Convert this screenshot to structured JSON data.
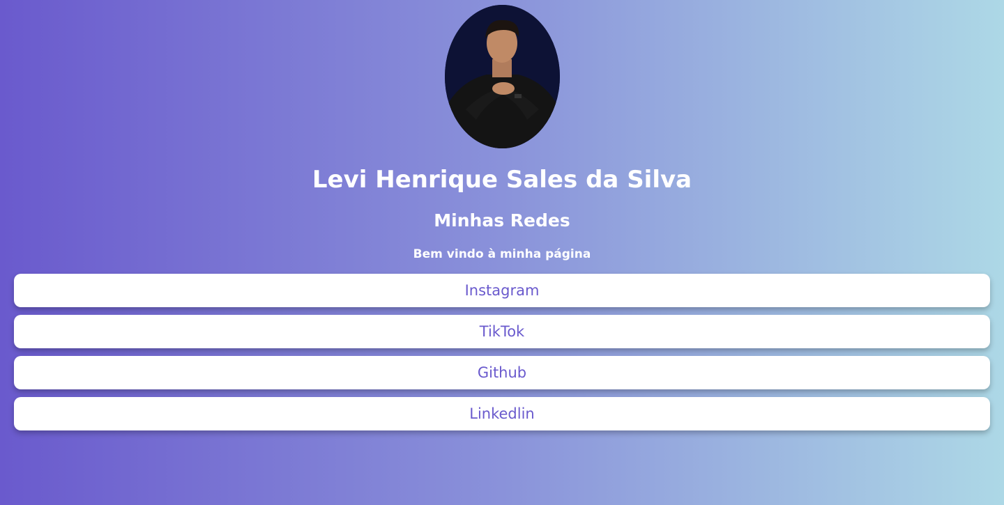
{
  "profile": {
    "photo_description_icon": "profile-photo",
    "name": "Levi Henrique Sales da Silva",
    "subtitle": "Minhas Redes",
    "welcome": "Bem vindo à minha página"
  },
  "links": [
    {
      "label": "Instagram"
    },
    {
      "label": "TikTok"
    },
    {
      "label": "Github"
    },
    {
      "label": "Linkedlin"
    }
  ],
  "colors": {
    "gradient_start": "#6a5acd",
    "gradient_end": "#add8e6",
    "button_bg": "#ffffff",
    "button_text": "#6a5acd",
    "heading_text": "#ffffff"
  }
}
